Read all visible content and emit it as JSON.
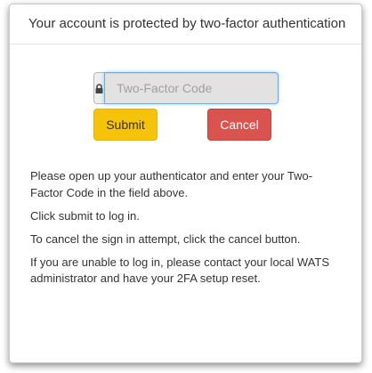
{
  "panel": {
    "heading": "Your account is protected by two-factor authentication"
  },
  "form": {
    "lock_icon": "lock-icon",
    "code_placeholder": "Two-Factor Code",
    "code_value": "",
    "submit_label": "Submit",
    "cancel_label": "Cancel"
  },
  "instructions": [
    "Please open up your authenticator and enter your Two-Factor Code in the field above.",
    "Click submit to log in.",
    "To cancel the sign in attempt, click the cancel button.",
    "If you are unable to log in, please contact your local WATS administrator and have your 2FA setup reset."
  ],
  "colors": {
    "submit": "#f7c30a",
    "cancel": "#d9534f",
    "focus_border": "#66afe9"
  }
}
